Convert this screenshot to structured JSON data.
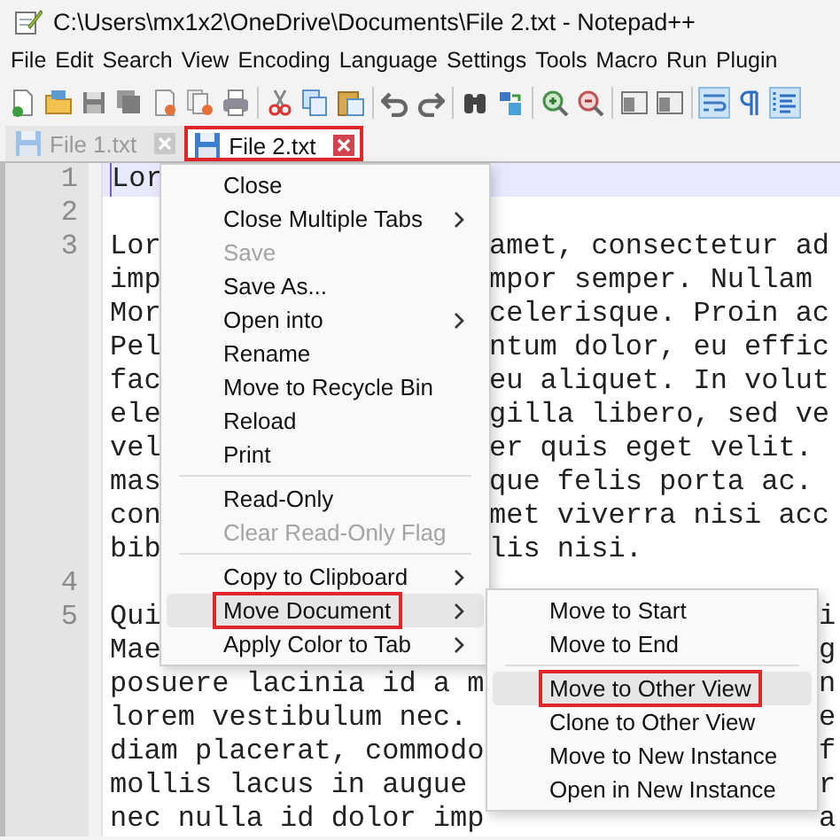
{
  "window": {
    "title": "C:\\Users\\mx1x2\\OneDrive\\Documents\\File 2.txt - Notepad++"
  },
  "menu_bar": [
    "File",
    "Edit",
    "Search",
    "View",
    "Encoding",
    "Language",
    "Settings",
    "Tools",
    "Macro",
    "Run",
    "Plugin"
  ],
  "toolbar": [
    {
      "kind": "new",
      "pressed": false
    },
    {
      "kind": "open",
      "pressed": false
    },
    {
      "kind": "save",
      "pressed": false
    },
    {
      "kind": "save-all",
      "pressed": false
    },
    {
      "kind": "close",
      "pressed": false
    },
    {
      "kind": "close-all",
      "pressed": false
    },
    {
      "kind": "print",
      "pressed": false
    },
    {
      "kind": "sep"
    },
    {
      "kind": "cut",
      "pressed": false
    },
    {
      "kind": "copy",
      "pressed": false
    },
    {
      "kind": "paste",
      "pressed": false
    },
    {
      "kind": "sep"
    },
    {
      "kind": "undo",
      "pressed": false
    },
    {
      "kind": "redo",
      "pressed": false
    },
    {
      "kind": "sep"
    },
    {
      "kind": "find",
      "pressed": false
    },
    {
      "kind": "replace",
      "pressed": false
    },
    {
      "kind": "sep"
    },
    {
      "kind": "zoom-in",
      "pressed": false
    },
    {
      "kind": "zoom-out",
      "pressed": false
    },
    {
      "kind": "sep"
    },
    {
      "kind": "panel",
      "pressed": false
    },
    {
      "kind": "panel",
      "pressed": false
    },
    {
      "kind": "sep"
    },
    {
      "kind": "wrap",
      "pressed": true
    },
    {
      "kind": "pilcrow",
      "pressed": false
    },
    {
      "kind": "indent",
      "pressed": true
    }
  ],
  "tabs": [
    {
      "label": "File 1.txt",
      "selected": false,
      "highlighted": false
    },
    {
      "label": "File 2.txt",
      "selected": true,
      "highlighted": true
    }
  ],
  "editor": {
    "lines": [
      {
        "number": "1",
        "left": "Lor",
        "current": true
      },
      {
        "number": "2",
        "current": false
      },
      {
        "number": "3",
        "left": "Lor",
        "after_menu": "amet, consectetur ad",
        "current": false
      },
      {
        "left": "imp",
        "after_menu": "mpor semper. Nullam",
        "current": false
      },
      {
        "left": "Mor",
        "after_menu": "celerisque. Proin ac",
        "current": false
      },
      {
        "left": "Pel",
        "after_menu": "ntum dolor, eu effic",
        "current": false
      },
      {
        "left": "fac",
        "after_menu": "eu aliquet. In volut",
        "current": false
      },
      {
        "left": "ele",
        "after_menu": "gilla libero, sed ve",
        "current": false
      },
      {
        "left": "vel",
        "after_menu": "er quis eget velit.",
        "current": false
      },
      {
        "left": "mas",
        "after_menu": "que felis porta ac.",
        "current": false
      },
      {
        "left": "con",
        "after_menu": "met viverra nisi acc",
        "current": false
      },
      {
        "left": "bib",
        "after_menu": "lis nisi.",
        "current": false
      },
      {
        "number": "4",
        "current": false
      },
      {
        "number": "5",
        "left": "Qui",
        "after_submenu": "i",
        "current": false
      },
      {
        "left": "Mae",
        "after_submenu": "g",
        "current": false
      },
      {
        "left": "posuere lacinia id a m",
        "after_submenu": "n",
        "current": false
      },
      {
        "left": "lorem vestibulum nec.",
        "after_submenu": "e",
        "current": false
      },
      {
        "left": "diam placerat, commodo",
        "after_submenu": "f",
        "current": false
      },
      {
        "left": "mollis lacus in augue",
        "after_submenu": "r",
        "current": false
      },
      {
        "left": "nec nulla id dolor imp",
        "after_submenu": "a",
        "current": false
      }
    ]
  },
  "context_menu": {
    "items": [
      {
        "kind": "item",
        "label": "Close",
        "disabled": false,
        "submenu": false,
        "hovered": false,
        "highlighted": false
      },
      {
        "kind": "item",
        "label": "Close Multiple Tabs",
        "disabled": false,
        "submenu": true,
        "hovered": false,
        "highlighted": false
      },
      {
        "kind": "item",
        "label": "Save",
        "disabled": true,
        "submenu": false,
        "hovered": false,
        "highlighted": false
      },
      {
        "kind": "item",
        "label": "Save As...",
        "disabled": false,
        "submenu": false,
        "hovered": false,
        "highlighted": false
      },
      {
        "kind": "item",
        "label": "Open into",
        "disabled": false,
        "submenu": true,
        "hovered": false,
        "highlighted": false
      },
      {
        "kind": "item",
        "label": "Rename",
        "disabled": false,
        "submenu": false,
        "hovered": false,
        "highlighted": false
      },
      {
        "kind": "item",
        "label": "Move to Recycle Bin",
        "disabled": false,
        "submenu": false,
        "hovered": false,
        "highlighted": false
      },
      {
        "kind": "item",
        "label": "Reload",
        "disabled": false,
        "submenu": false,
        "hovered": false,
        "highlighted": false
      },
      {
        "kind": "item",
        "label": "Print",
        "disabled": false,
        "submenu": false,
        "hovered": false,
        "highlighted": false
      },
      {
        "kind": "separator"
      },
      {
        "kind": "item",
        "label": "Read-Only",
        "disabled": false,
        "submenu": false,
        "hovered": false,
        "highlighted": false
      },
      {
        "kind": "item",
        "label": "Clear Read-Only Flag",
        "disabled": true,
        "submenu": false,
        "hovered": false,
        "highlighted": false
      },
      {
        "kind": "separator"
      },
      {
        "kind": "item",
        "label": "Copy to Clipboard",
        "disabled": false,
        "submenu": true,
        "hovered": false,
        "highlighted": false
      },
      {
        "kind": "item",
        "label": "Move Document",
        "disabled": false,
        "submenu": true,
        "hovered": true,
        "highlighted": true
      },
      {
        "kind": "item",
        "label": "Apply Color to Tab",
        "disabled": false,
        "submenu": true,
        "hovered": false,
        "highlighted": false
      }
    ]
  },
  "submenu": {
    "items": [
      {
        "kind": "item",
        "label": "Move to Start",
        "disabled": false,
        "submenu": false,
        "hovered": false,
        "highlighted": false
      },
      {
        "kind": "item",
        "label": "Move to End",
        "disabled": false,
        "submenu": false,
        "hovered": false,
        "highlighted": false
      },
      {
        "kind": "separator"
      },
      {
        "kind": "item",
        "label": "Move to Other View",
        "disabled": false,
        "submenu": false,
        "hovered": true,
        "highlighted": true
      },
      {
        "kind": "item",
        "label": "Clone to Other View",
        "disabled": false,
        "submenu": false,
        "hovered": false,
        "highlighted": false
      },
      {
        "kind": "item",
        "label": "Move to New Instance",
        "disabled": false,
        "submenu": false,
        "hovered": false,
        "highlighted": false
      },
      {
        "kind": "item",
        "label": "Open in New Instance",
        "disabled": false,
        "submenu": false,
        "hovered": false,
        "highlighted": false
      }
    ]
  }
}
